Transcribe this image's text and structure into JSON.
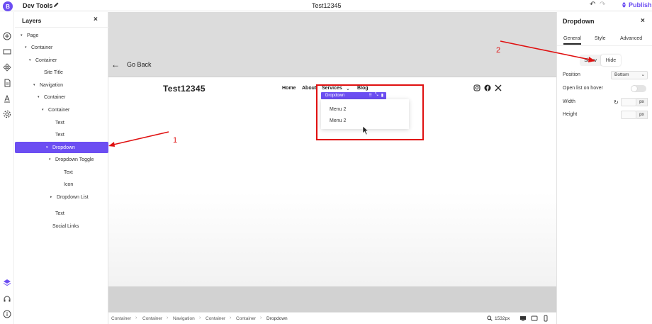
{
  "app": {
    "logo_text": "B",
    "title": "Dev Tools",
    "document_title": "Test12345",
    "publish_label": "Publish",
    "accent": "#6c4ef2"
  },
  "rail_icons": [
    "add-icon",
    "layout-icon",
    "components-icon",
    "pages-icon",
    "typography-icon",
    "settings-icon",
    "layers-icon",
    "support-icon",
    "info-icon"
  ],
  "layers": {
    "title": "Layers",
    "items": [
      {
        "label": "Page",
        "expand": "▾"
      },
      {
        "label": "Container",
        "expand": "▾"
      },
      {
        "label": "Container",
        "expand": "▾"
      },
      {
        "label": "Site Title",
        "expand": ""
      },
      {
        "label": "Navigation",
        "expand": "▾"
      },
      {
        "label": "Container",
        "expand": "▾"
      },
      {
        "label": "Container",
        "expand": "▾"
      },
      {
        "label": "Text",
        "expand": ""
      },
      {
        "label": "Text",
        "expand": ""
      },
      {
        "label": "Dropdown",
        "expand": "▾"
      },
      {
        "label": "Dropdown Toggle",
        "expand": "▾"
      },
      {
        "label": "Text",
        "expand": ""
      },
      {
        "label": "Icon",
        "expand": ""
      },
      {
        "label": "Dropdown List",
        "expand": "▸"
      },
      {
        "label": "Text",
        "expand": ""
      },
      {
        "label": "Social Links",
        "expand": ""
      }
    ]
  },
  "canvas": {
    "go_back": "Go Back",
    "site_title": "Test12345",
    "nav": {
      "home": "Home",
      "about": "About",
      "services": "Services",
      "blog": "Blog"
    },
    "dropdown_toolbar_label": "Dropdown",
    "dropdown_items": [
      "Menu 2",
      "Menu 2"
    ]
  },
  "breadcrumb": {
    "items": [
      "Container",
      "Container",
      "Navigation",
      "Container",
      "Container",
      "Dropdown"
    ],
    "separator": "›",
    "zoom": "1532px"
  },
  "right_panel": {
    "title": "Dropdown",
    "tabs": [
      "General",
      "Style",
      "Advanced"
    ],
    "show_label": "Show",
    "hide_label": "Hide",
    "position_label": "Position",
    "position_value": "Bottom",
    "open_on_hover_label": "Open list on hover",
    "width_label": "Width",
    "height_label": "Height",
    "unit": "px"
  },
  "annotations": {
    "one": "1",
    "two": "2",
    "color": "#e01010"
  }
}
